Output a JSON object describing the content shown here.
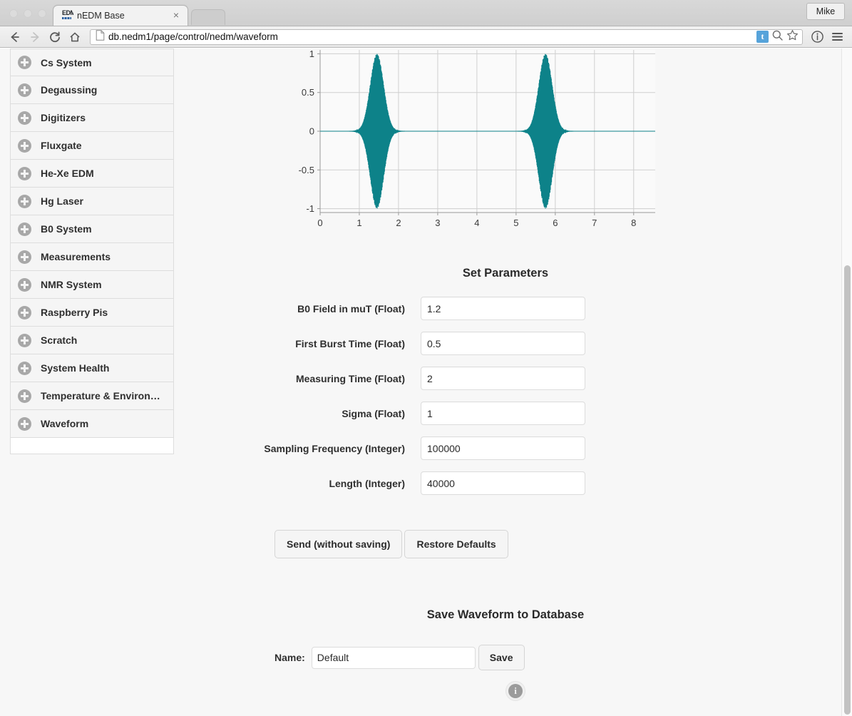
{
  "browser": {
    "tab": {
      "title": "nEDM Base",
      "favicon_text": "EDM",
      "favicon_name": "nedm-logo-favicon",
      "close_label": "×"
    },
    "profile_button": "Mike",
    "url": "db.nedm1/page/control/nedm/waveform",
    "nav": {
      "back": "←",
      "forward": "→",
      "reload": "↻",
      "home": "⌂",
      "page_icon": "📄",
      "tumblr_badge": "t",
      "search": "search-icon",
      "bookmark": "star-icon",
      "info": "info-icon",
      "menu": "hamburger-menu-icon"
    }
  },
  "sidebar": {
    "items": [
      {
        "label": "Cs System"
      },
      {
        "label": "Degaussing"
      },
      {
        "label": "Digitizers"
      },
      {
        "label": "Fluxgate"
      },
      {
        "label": "He-Xe EDM"
      },
      {
        "label": "Hg Laser"
      },
      {
        "label": "B0 System"
      },
      {
        "label": "Measurements"
      },
      {
        "label": "NMR System"
      },
      {
        "label": "Raspberry Pis"
      },
      {
        "label": "Scratch"
      },
      {
        "label": "System Health"
      },
      {
        "label": "Temperature & Environ…"
      },
      {
        "label": "Waveform"
      }
    ]
  },
  "main": {
    "set_parameters_heading": "Set Parameters",
    "parameters": [
      {
        "label": "B0 Field in muT (Float)",
        "value": "1.2"
      },
      {
        "label": "First Burst Time (Float)",
        "value": "0.5"
      },
      {
        "label": "Measuring Time (Float)",
        "value": "2"
      },
      {
        "label": "Sigma (Float)",
        "value": "1"
      },
      {
        "label": "Sampling Frequency (Integer)",
        "value": "100000"
      },
      {
        "label": "Length (Integer)",
        "value": "40000"
      }
    ],
    "buttons": {
      "send": "Send (without saving)",
      "restore": "Restore Defaults"
    },
    "save_section": {
      "heading": "Save Waveform to Database",
      "name_label": "Name:",
      "name_value": "Default",
      "save_button": "Save"
    },
    "footer_info": "i"
  },
  "colors": {
    "waveform": "#0d8289",
    "grid": "#cfcfcf",
    "plot_background": "#fafafa",
    "page_background": "#f7f7f7",
    "sidebar_item": "#f5f5f5",
    "badge_blue": "#56a3da"
  },
  "chart_data": {
    "type": "line",
    "title": "",
    "xlabel": "",
    "ylabel": "",
    "xlim": [
      0,
      8.55
    ],
    "ylim": [
      -1.05,
      1.05
    ],
    "xticks": [
      0,
      1,
      2,
      3,
      4,
      5,
      6,
      7,
      8
    ],
    "yticks": [
      -1,
      -0.5,
      0,
      0.5,
      1
    ],
    "ytick_labels": [
      "-1",
      "-0.5",
      "0",
      "0.5",
      "1"
    ],
    "grid": true,
    "legend": null,
    "series": [
      {
        "name": "waveform",
        "color": "#0d8289",
        "description": "Two Gaussian-enveloped oscillating bursts on a zero baseline",
        "bursts": [
          {
            "center": 1.45,
            "sigma": 0.17,
            "amplitude": 1.0,
            "frequency_hz": 102
          },
          {
            "center": 5.75,
            "sigma": 0.17,
            "amplitude": 1.0,
            "frequency_hz": 102
          }
        ]
      }
    ]
  }
}
